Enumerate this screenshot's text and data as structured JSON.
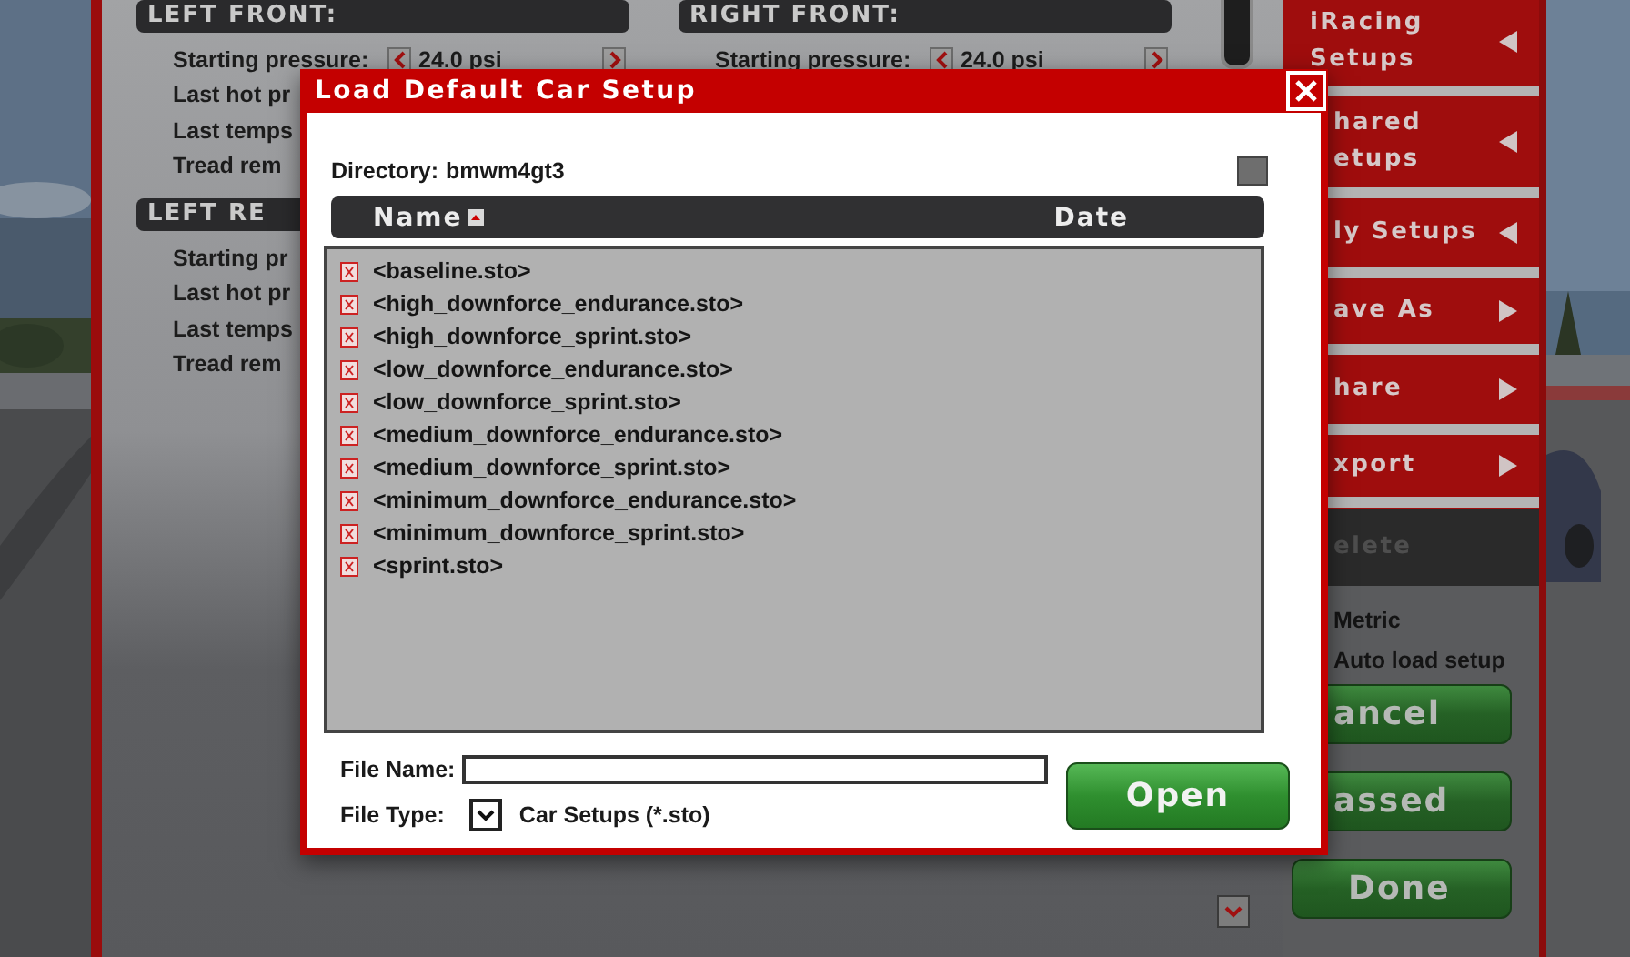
{
  "tire_panel": {
    "columns": [
      {
        "sections": [
          {
            "title": "LEFT FRONT:",
            "rows": [
              {
                "kind": "stepper",
                "label": "Starting pressure:",
                "value": "24.0 psi"
              },
              {
                "kind": "text",
                "label": "Last hot pr"
              },
              {
                "kind": "text",
                "label": "Last temps"
              },
              {
                "kind": "text",
                "label": "Tread rem"
              }
            ]
          },
          {
            "title": "LEFT RE",
            "rows": [
              {
                "kind": "text",
                "label": "Starting pr"
              },
              {
                "kind": "text",
                "label": "Last hot pr"
              },
              {
                "kind": "text",
                "label": "Last temps"
              },
              {
                "kind": "text",
                "label": "Tread rem"
              }
            ]
          }
        ]
      },
      {
        "sections": [
          {
            "title": "RIGHT FRONT:",
            "rows": [
              {
                "kind": "stepper",
                "label": "Starting pressure:",
                "value": "24.0 psi"
              }
            ]
          }
        ]
      }
    ]
  },
  "sidebar": {
    "items": [
      {
        "kind": "submenu",
        "label": "iRacing Setups",
        "disabled": false
      },
      {
        "kind": "submenu",
        "label": "hared etups",
        "disabled": false
      },
      {
        "kind": "submenu",
        "label": "ly Setups",
        "disabled": false
      },
      {
        "kind": "action",
        "label": "ave As",
        "disabled": false
      },
      {
        "kind": "action",
        "label": "hare",
        "disabled": false
      },
      {
        "kind": "action",
        "label": "xport",
        "disabled": false
      },
      {
        "kind": "plain",
        "label": "elete",
        "disabled": true
      }
    ],
    "options": [
      "Metric",
      "Auto load setup"
    ],
    "buttons": [
      "ancel",
      "assed",
      "Done"
    ]
  },
  "dialog": {
    "title": "Load Default Car Setup",
    "directory": {
      "label": "Directory:",
      "value": "bmwm4gt3"
    },
    "columns": [
      {
        "label": "Name",
        "sorted": true
      },
      {
        "label": "Date",
        "sorted": false
      }
    ],
    "files": [
      "<baseline.sto>",
      "<high_downforce_endurance.sto>",
      "<high_downforce_sprint.sto>",
      "<low_downforce_endurance.sto>",
      "<low_downforce_sprint.sto>",
      "<medium_downforce_endurance.sto>",
      "<medium_downforce_sprint.sto>",
      "<minimum_downforce_endurance.sto>",
      "<minimum_downforce_sprint.sto>",
      "<sprint.sto>"
    ],
    "file_name": {
      "label": "File Name:"
    },
    "file_type": {
      "label": "File Type:",
      "value": "Car Setups (*.sto)"
    },
    "open_button": "Open"
  }
}
